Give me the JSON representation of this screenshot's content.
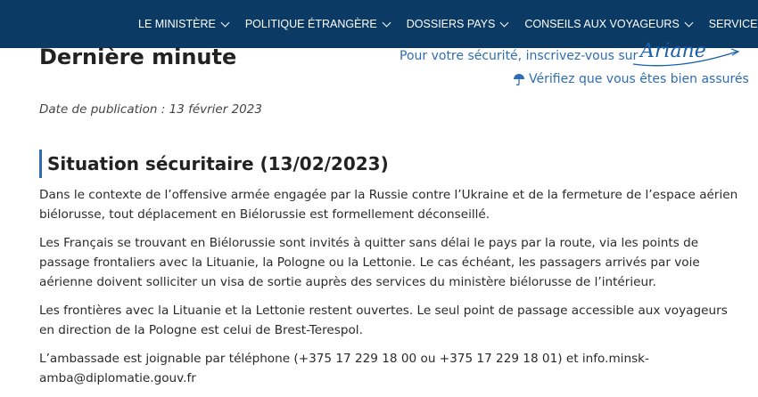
{
  "nav": {
    "items": [
      {
        "label": "LE MINISTÈRE"
      },
      {
        "label": "POLITIQUE ÉTRANGÈRE"
      },
      {
        "label": "DOSSIERS PAYS"
      },
      {
        "label": "CONSEILS AUX VOYAGEURS"
      },
      {
        "label": "SERVICES AU"
      }
    ]
  },
  "page": {
    "title": "Dernière minute",
    "publication_date": "Date de publication : 13 février 2023"
  },
  "aside": {
    "register_text": "Pour votre sécurité, inscrivez-vous sur",
    "ariane_logo_text": "Ariane",
    "insurance_text": "Vérifiez que vous êtes bien assurés"
  },
  "section": {
    "heading": "Situation sécuritaire (13/02/2023)",
    "paragraphs": [
      "Dans le contexte de l’offensive armée engagée par la Russie contre l’Ukraine et de la fermeture de l’espace aérien biélorusse, tout déplacement en Biélorussie est formellement déconseillé.",
      "Les Français se trouvant en Biélorussie sont invités à quitter sans délai le pays par la route, via les points de passage frontaliers avec la Lituanie, la Pologne ou la Lettonie. Le cas échéant, les passagers arrivés par voie aérienne doivent solliciter un visa de sortie auprès des services du ministère biélorusse de l’intérieur.",
      "Les frontières avec la Lituanie et la Lettonie restent ouvertes. Le seul point de passage accessible aux voyageurs en direction de la Pologne est celui de Brest-Terespol.",
      "L’ambassade est joignable par téléphone (+375 17 229 18 00 ou +375 17 229 18 01) et info.minsk-amba@diplomatie.gouv.fr"
    ]
  },
  "colors": {
    "navbar_bg": "#0b3a64",
    "link": "#2e6db4",
    "heading_accent": "#2e6db4"
  }
}
